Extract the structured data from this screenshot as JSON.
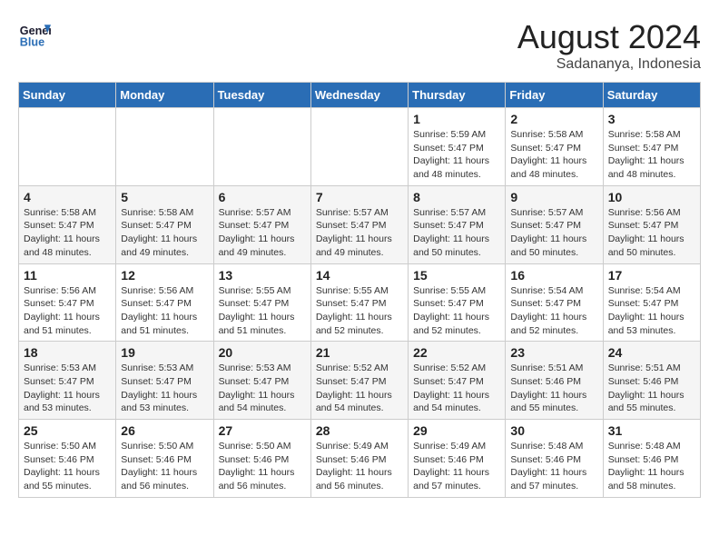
{
  "header": {
    "logo_line1": "General",
    "logo_line2": "Blue",
    "month_year": "August 2024",
    "location": "Sadananya, Indonesia"
  },
  "weekdays": [
    "Sunday",
    "Monday",
    "Tuesday",
    "Wednesday",
    "Thursday",
    "Friday",
    "Saturday"
  ],
  "weeks": [
    [
      {
        "day": "",
        "info": ""
      },
      {
        "day": "",
        "info": ""
      },
      {
        "day": "",
        "info": ""
      },
      {
        "day": "",
        "info": ""
      },
      {
        "day": "1",
        "info": "Sunrise: 5:59 AM\nSunset: 5:47 PM\nDaylight: 11 hours\nand 48 minutes."
      },
      {
        "day": "2",
        "info": "Sunrise: 5:58 AM\nSunset: 5:47 PM\nDaylight: 11 hours\nand 48 minutes."
      },
      {
        "day": "3",
        "info": "Sunrise: 5:58 AM\nSunset: 5:47 PM\nDaylight: 11 hours\nand 48 minutes."
      }
    ],
    [
      {
        "day": "4",
        "info": "Sunrise: 5:58 AM\nSunset: 5:47 PM\nDaylight: 11 hours\nand 48 minutes."
      },
      {
        "day": "5",
        "info": "Sunrise: 5:58 AM\nSunset: 5:47 PM\nDaylight: 11 hours\nand 49 minutes."
      },
      {
        "day": "6",
        "info": "Sunrise: 5:57 AM\nSunset: 5:47 PM\nDaylight: 11 hours\nand 49 minutes."
      },
      {
        "day": "7",
        "info": "Sunrise: 5:57 AM\nSunset: 5:47 PM\nDaylight: 11 hours\nand 49 minutes."
      },
      {
        "day": "8",
        "info": "Sunrise: 5:57 AM\nSunset: 5:47 PM\nDaylight: 11 hours\nand 50 minutes."
      },
      {
        "day": "9",
        "info": "Sunrise: 5:57 AM\nSunset: 5:47 PM\nDaylight: 11 hours\nand 50 minutes."
      },
      {
        "day": "10",
        "info": "Sunrise: 5:56 AM\nSunset: 5:47 PM\nDaylight: 11 hours\nand 50 minutes."
      }
    ],
    [
      {
        "day": "11",
        "info": "Sunrise: 5:56 AM\nSunset: 5:47 PM\nDaylight: 11 hours\nand 51 minutes."
      },
      {
        "day": "12",
        "info": "Sunrise: 5:56 AM\nSunset: 5:47 PM\nDaylight: 11 hours\nand 51 minutes."
      },
      {
        "day": "13",
        "info": "Sunrise: 5:55 AM\nSunset: 5:47 PM\nDaylight: 11 hours\nand 51 minutes."
      },
      {
        "day": "14",
        "info": "Sunrise: 5:55 AM\nSunset: 5:47 PM\nDaylight: 11 hours\nand 52 minutes."
      },
      {
        "day": "15",
        "info": "Sunrise: 5:55 AM\nSunset: 5:47 PM\nDaylight: 11 hours\nand 52 minutes."
      },
      {
        "day": "16",
        "info": "Sunrise: 5:54 AM\nSunset: 5:47 PM\nDaylight: 11 hours\nand 52 minutes."
      },
      {
        "day": "17",
        "info": "Sunrise: 5:54 AM\nSunset: 5:47 PM\nDaylight: 11 hours\nand 53 minutes."
      }
    ],
    [
      {
        "day": "18",
        "info": "Sunrise: 5:53 AM\nSunset: 5:47 PM\nDaylight: 11 hours\nand 53 minutes."
      },
      {
        "day": "19",
        "info": "Sunrise: 5:53 AM\nSunset: 5:47 PM\nDaylight: 11 hours\nand 53 minutes."
      },
      {
        "day": "20",
        "info": "Sunrise: 5:53 AM\nSunset: 5:47 PM\nDaylight: 11 hours\nand 54 minutes."
      },
      {
        "day": "21",
        "info": "Sunrise: 5:52 AM\nSunset: 5:47 PM\nDaylight: 11 hours\nand 54 minutes."
      },
      {
        "day": "22",
        "info": "Sunrise: 5:52 AM\nSunset: 5:47 PM\nDaylight: 11 hours\nand 54 minutes."
      },
      {
        "day": "23",
        "info": "Sunrise: 5:51 AM\nSunset: 5:46 PM\nDaylight: 11 hours\nand 55 minutes."
      },
      {
        "day": "24",
        "info": "Sunrise: 5:51 AM\nSunset: 5:46 PM\nDaylight: 11 hours\nand 55 minutes."
      }
    ],
    [
      {
        "day": "25",
        "info": "Sunrise: 5:50 AM\nSunset: 5:46 PM\nDaylight: 11 hours\nand 55 minutes."
      },
      {
        "day": "26",
        "info": "Sunrise: 5:50 AM\nSunset: 5:46 PM\nDaylight: 11 hours\nand 56 minutes."
      },
      {
        "day": "27",
        "info": "Sunrise: 5:50 AM\nSunset: 5:46 PM\nDaylight: 11 hours\nand 56 minutes."
      },
      {
        "day": "28",
        "info": "Sunrise: 5:49 AM\nSunset: 5:46 PM\nDaylight: 11 hours\nand 56 minutes."
      },
      {
        "day": "29",
        "info": "Sunrise: 5:49 AM\nSunset: 5:46 PM\nDaylight: 11 hours\nand 57 minutes."
      },
      {
        "day": "30",
        "info": "Sunrise: 5:48 AM\nSunset: 5:46 PM\nDaylight: 11 hours\nand 57 minutes."
      },
      {
        "day": "31",
        "info": "Sunrise: 5:48 AM\nSunset: 5:46 PM\nDaylight: 11 hours\nand 58 minutes."
      }
    ]
  ]
}
